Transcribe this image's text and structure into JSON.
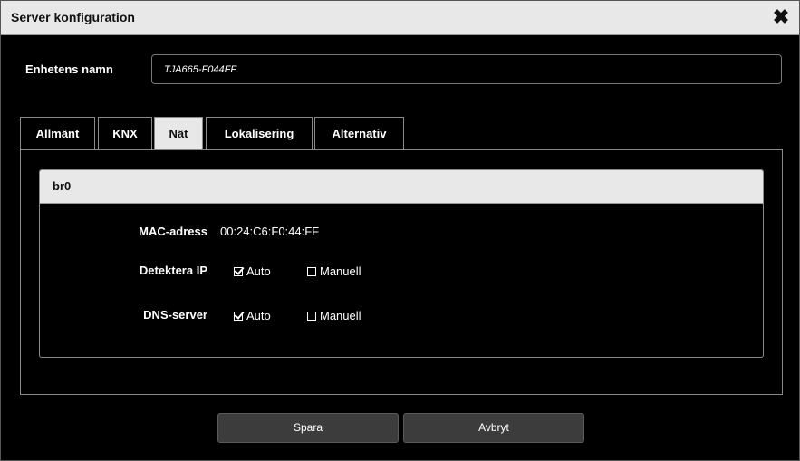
{
  "dialog": {
    "title": "Server konfiguration",
    "close_glyph": "✖"
  },
  "device_name": {
    "label": "Enhetens namn",
    "value": "TJA665-F044FF"
  },
  "tabs": [
    {
      "label": "Allmänt"
    },
    {
      "label": "KNX"
    },
    {
      "label": "Nät",
      "active": true
    },
    {
      "label": "Lokalisering"
    },
    {
      "label": "Alternativ"
    }
  ],
  "network": {
    "interface_name": "br0",
    "mac": {
      "label": "MAC-adress",
      "value": "00:24:C6:F0:44:FF"
    },
    "detect_ip": {
      "label": "Detektera IP",
      "auto": {
        "label": "Auto",
        "checked": true
      },
      "manual": {
        "label": "Manuell",
        "checked": false
      }
    },
    "dns": {
      "label": "DNS-server",
      "auto": {
        "label": "Auto",
        "checked": true
      },
      "manual": {
        "label": "Manuell",
        "checked": false
      }
    }
  },
  "buttons": {
    "save": "Spara",
    "cancel": "Avbryt"
  },
  "colors": {
    "background": "#000000",
    "header_bg": "#e8e8e8",
    "button_bg": "#3c3c3c"
  }
}
